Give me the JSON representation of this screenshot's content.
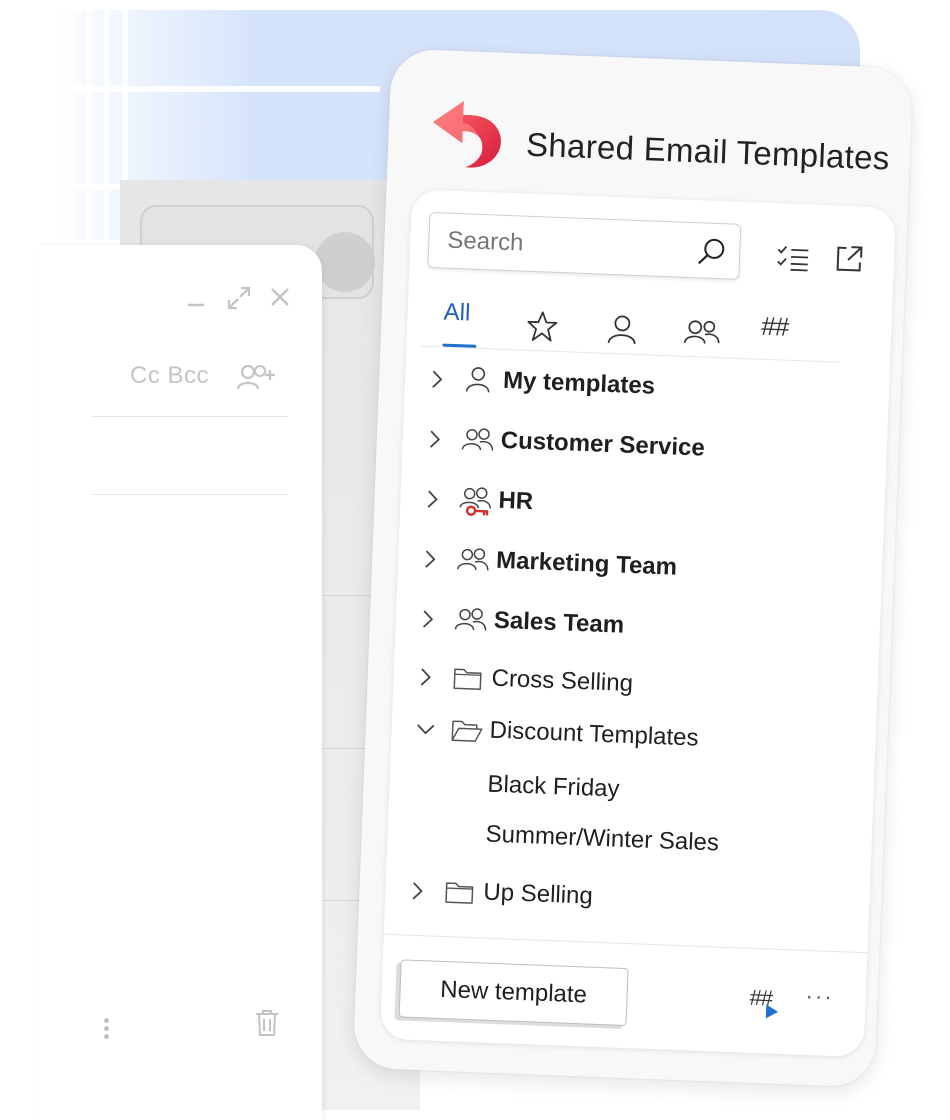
{
  "panel": {
    "title": "Shared Email Templates",
    "search": {
      "placeholder": "Search"
    },
    "tabs": [
      {
        "id": "all",
        "label": "All",
        "active": true
      },
      {
        "id": "favorites",
        "icon": "star-icon"
      },
      {
        "id": "mine",
        "icon": "person-icon"
      },
      {
        "id": "shared",
        "icon": "people-icon"
      },
      {
        "id": "macros",
        "label": "##"
      }
    ],
    "tree": [
      {
        "label": "My templates",
        "icon": "person-icon",
        "bold": true,
        "expanded": false
      },
      {
        "label": "Customer Service",
        "icon": "people-icon",
        "bold": true,
        "expanded": false
      },
      {
        "label": "HR",
        "icon": "people-key-icon",
        "bold": true,
        "expanded": false
      },
      {
        "label": "Marketing Team",
        "icon": "people-icon",
        "bold": true,
        "expanded": false
      },
      {
        "label": "Sales Team",
        "icon": "people-icon",
        "bold": true,
        "expanded": false
      },
      {
        "label": "Cross Selling",
        "icon": "folder-icon",
        "bold": false,
        "expanded": false
      },
      {
        "label": "Discount Templates",
        "icon": "folder-open-icon",
        "bold": false,
        "expanded": true,
        "children": [
          {
            "label": "Black Friday"
          },
          {
            "label": "Summer/Winter Sales"
          }
        ]
      },
      {
        "label": "Up Selling",
        "icon": "folder-icon",
        "bold": false,
        "expanded": false
      }
    ],
    "footer": {
      "new_template_label": "New template",
      "macro_label": "##",
      "more_label": "···"
    }
  },
  "compose": {
    "cc_bcc_label": "Cc Bcc"
  },
  "colors": {
    "accent": "#1f6fd1",
    "logo": "#e53945",
    "key": "#d32f2f"
  }
}
